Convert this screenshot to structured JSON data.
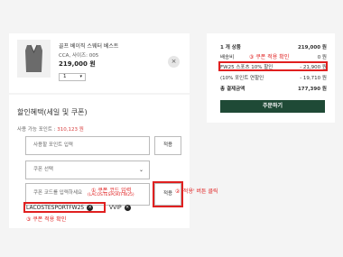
{
  "product": {
    "name": "골프 베이직 스웨터 베스트",
    "meta": "CCA, 사이즈: 005",
    "price": "219,000 원",
    "quantity": "1",
    "remove_label": "×"
  },
  "discount": {
    "title": "할인혜택(세일 및 쿠폰)",
    "points_label": "사용 가능 포인트 : ",
    "points_value": "310,123 원",
    "points_placeholder": "사용할 포인트 입력",
    "points_apply": "적용",
    "coupon_select": "쿠폰 선택",
    "code_placeholder": "쿠폰 코드를 입력하세요",
    "code_apply": "적용",
    "applied_codes": [
      "LACOSTESPORTFW25",
      "VVIP"
    ]
  },
  "annotations": {
    "step1": "① 쿠폰 코드 입력",
    "step1_sub": "(LACOSTESPORTFW25)",
    "step2": "② '적용' 버튼 클릭",
    "step3_left": "③ 쿠폰 적용 확인",
    "step3_right": "③ 쿠폰 적용 확인"
  },
  "summary": {
    "rows": [
      {
        "label": "1 개 상품",
        "value": "219,000 원"
      },
      {
        "label": "배송비",
        "value": "0 원"
      },
      {
        "label": "FW25 스포츠 10% 할인",
        "value": "- 21,900 원"
      },
      {
        "label": "(10% 포인트 연할인",
        "value": "- 19,710 원"
      },
      {
        "label": "총 결제금액",
        "value": "177,390 원"
      }
    ],
    "checkout_label": "주문하기"
  },
  "colors": {
    "accent_red": "#e02020",
    "checkout_green": "#1f4a36"
  }
}
